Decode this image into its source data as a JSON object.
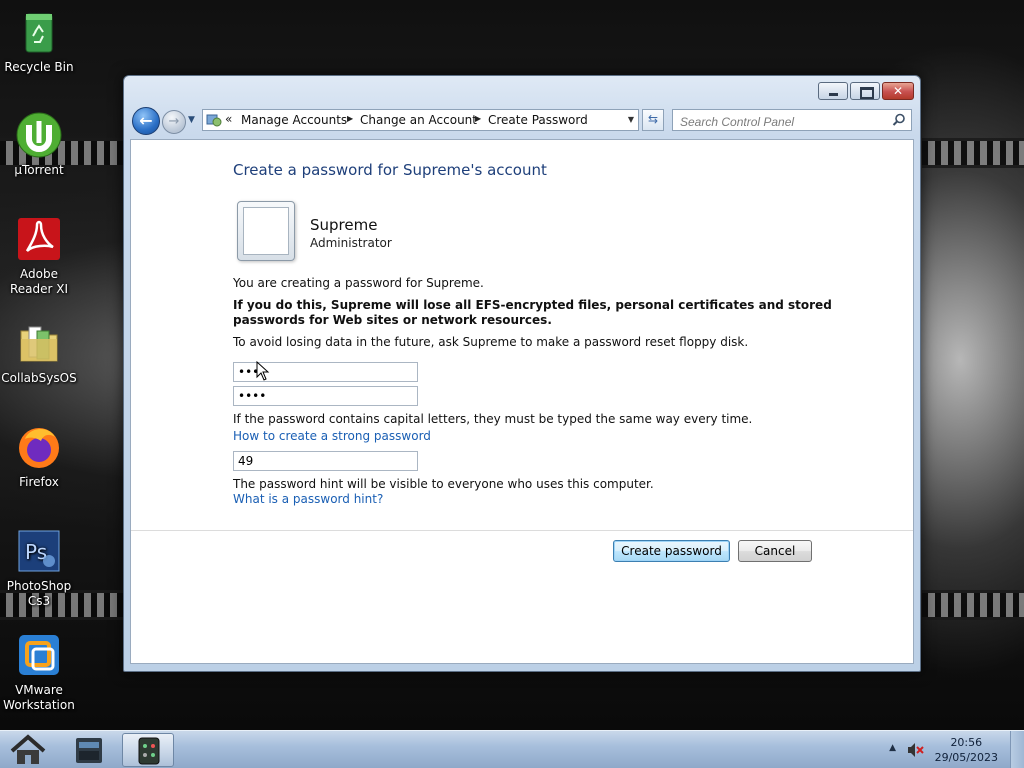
{
  "desktop": {
    "icons": [
      {
        "label": "Recycle Bin",
        "icon": "recycle-bin-icon"
      },
      {
        "label": "µTorrent",
        "icon": "utorrent-icon"
      },
      {
        "label": "Adobe Reader XI",
        "icon": "adobe-reader-icon"
      },
      {
        "label": "CollabSysOS",
        "icon": "folder-icon"
      },
      {
        "label": "Firefox",
        "icon": "firefox-icon"
      },
      {
        "label": "PhotoShop Cs3",
        "icon": "photoshop-icon"
      },
      {
        "label": "VMware Workstation",
        "icon": "vmware-icon"
      }
    ]
  },
  "window": {
    "breadcrumb": {
      "overflow": "«",
      "items": [
        "Manage Accounts",
        "Change an Account",
        "Create Password"
      ]
    },
    "search": {
      "placeholder": "Search Control Panel"
    },
    "page": {
      "title": "Create a password for Supreme's account",
      "user_name": "Supreme",
      "user_role": "Administrator",
      "intro": "You are creating a password for Supreme.",
      "warning": "If you do this, Supreme will lose all EFS-encrypted files, personal certificates and stored passwords for Web sites or network resources.",
      "advice": "To avoid losing data in the future, ask Supreme to make a password reset floppy disk.",
      "new_password_value": "•••",
      "confirm_password_value": "••••",
      "case_note": "If the password contains capital letters, they must be typed the same way every time.",
      "strong_password_link": "How to create a strong password",
      "hint_value": "49",
      "hint_note": "The password hint will be visible to everyone who uses this computer.",
      "hint_link": "What is a password hint?",
      "create_button": "Create password",
      "cancel_button": "Cancel"
    }
  },
  "taskbar": {
    "items": [
      "home-icon",
      "file-manager-icon",
      "calculator-icon"
    ],
    "clock_time": "20:56",
    "clock_date": "29/05/2023"
  },
  "colors": {
    "title_text": "#1e3f7a",
    "link": "#1a5fb4",
    "taskbar": "#a7bfdc"
  }
}
